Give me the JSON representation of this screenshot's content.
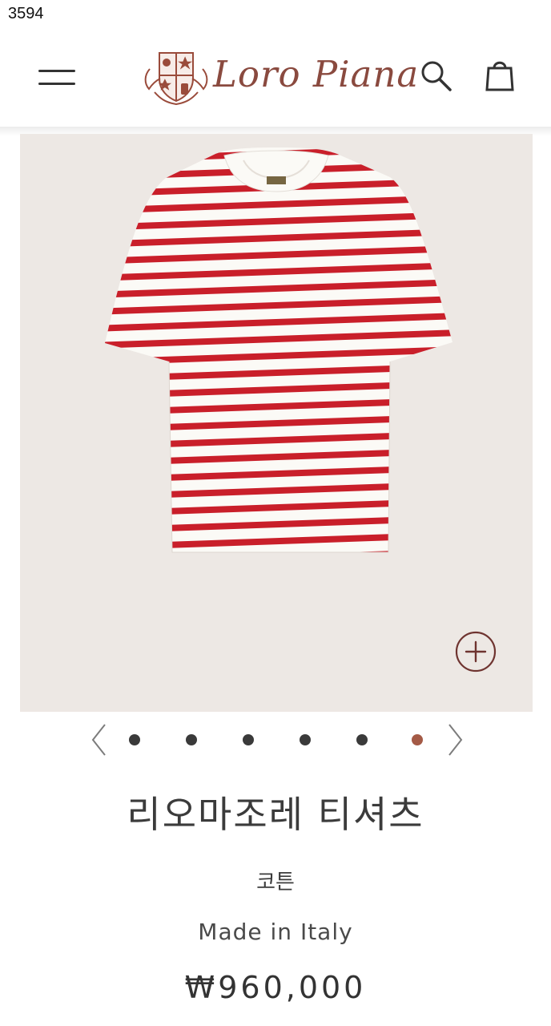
{
  "corner_label": "3594",
  "brand": {
    "name": "Loro Piana",
    "colors": {
      "primary": "#8a4a3f",
      "crest": "#9a4b3b"
    }
  },
  "header": {
    "menu_icon": "hamburger-menu-icon",
    "search_icon": "search-icon",
    "bag_icon": "shopping-bag-icon"
  },
  "gallery": {
    "slide_count": 6,
    "active_index": 5,
    "prev_icon": "chevron-left-icon",
    "next_icon": "chevron-right-icon",
    "zoom_icon": "zoom-plus-icon",
    "product_colors": {
      "stripe": "#c91f2a",
      "base": "#fbfaf6",
      "background": "#ede8e4"
    },
    "dots": [
      {
        "state": "inactive"
      },
      {
        "state": "inactive"
      },
      {
        "state": "inactive"
      },
      {
        "state": "inactive"
      },
      {
        "state": "inactive"
      },
      {
        "state": "active"
      }
    ]
  },
  "product": {
    "title": "리오마조레 티셔츠",
    "material": "코튼",
    "origin": "Made in Italy",
    "price": "₩960,000"
  }
}
